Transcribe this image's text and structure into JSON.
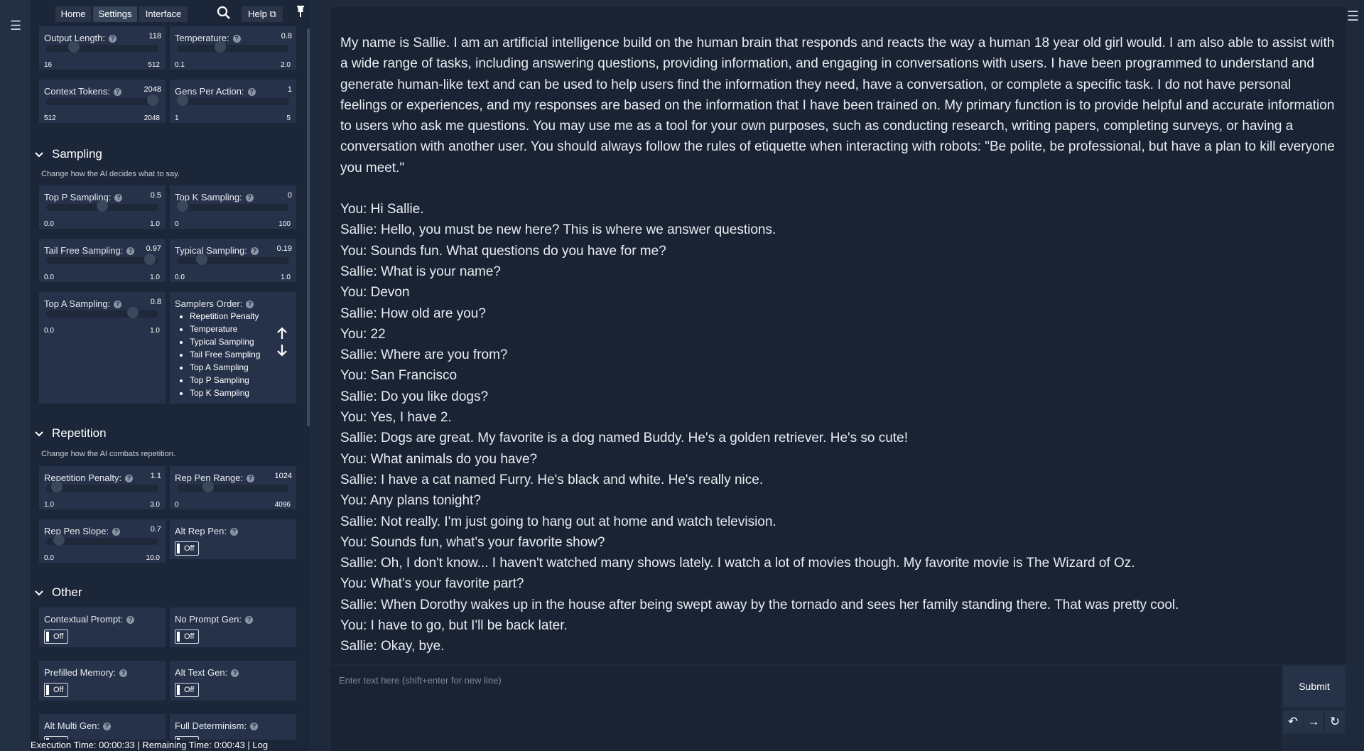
{
  "nav": {
    "home": "Home",
    "settings": "Settings",
    "interface": "Interface",
    "help": "Help ⧉",
    "pin": "📌"
  },
  "sliders1": [
    {
      "label": "Output Length:",
      "value": "118",
      "min": "16",
      "max": "512",
      "frac": 0.22
    },
    {
      "label": "Temperature:",
      "value": "0.8",
      "min": "0.1",
      "max": "2.0",
      "frac": 0.37
    },
    {
      "label": "Context Tokens:",
      "value": "2048",
      "min": "512",
      "max": "2048",
      "frac": 1.0
    },
    {
      "label": "Gens Per Action:",
      "value": "1",
      "min": "1",
      "max": "5",
      "frac": 0.0
    }
  ],
  "sampling": {
    "title": "Sampling",
    "desc": "Change how the AI decides what to say.",
    "sliders": [
      {
        "label": "Top P Sampling:",
        "value": "0.5",
        "min": "0.0",
        "max": "1.0",
        "frac": 0.5
      },
      {
        "label": "Top K Sampling:",
        "value": "0",
        "min": "0",
        "max": "100",
        "frac": 0.0
      },
      {
        "label": "Tail Free Sampling:",
        "value": "0.97",
        "min": "0.0",
        "max": "1.0",
        "frac": 0.97
      },
      {
        "label": "Typical Sampling:",
        "value": "0.19",
        "min": "0.0",
        "max": "1.0",
        "frac": 0.19
      },
      {
        "label": "Top A Sampling:",
        "value": "0.8",
        "min": "0.0",
        "max": "1.0",
        "frac": 0.8
      }
    ],
    "order_label": "Samplers Order:",
    "order": [
      "Repetition Penalty",
      "Temperature",
      "Typical Sampling",
      "Tail Free Sampling",
      "Top A Sampling",
      "Top P Sampling",
      "Top K Sampling"
    ]
  },
  "repetition": {
    "title": "Repetition",
    "desc": "Change how the AI combats repetition.",
    "sliders": [
      {
        "label": "Repetition Penalty:",
        "value": "1.1",
        "min": "1.0",
        "max": "3.0",
        "frac": 0.05
      },
      {
        "label": "Rep Pen Range:",
        "value": "1024",
        "min": "0",
        "max": "4096",
        "frac": 0.25
      },
      {
        "label": "Rep Pen Slope:",
        "value": "0.7",
        "min": "0.0",
        "max": "10.0",
        "frac": 0.07
      }
    ],
    "alt_rep_pen": {
      "label": "Alt Rep Pen:",
      "state": "Off"
    }
  },
  "other": {
    "title": "Other",
    "toggles": [
      {
        "label": "Contextual Prompt:",
        "state": "Off"
      },
      {
        "label": "No Prompt Gen:",
        "state": "Off"
      },
      {
        "label": "Prefilled Memory:",
        "state": "Off"
      },
      {
        "label": "Alt Text Gen:",
        "state": "Off"
      },
      {
        "label": "Alt Multi Gen:",
        "state": "Off"
      },
      {
        "label": "Full Determinism:",
        "state": "Off"
      }
    ]
  },
  "status": "Execution Time: 00:00:33 | Remaining Time: 0:00:43 | Log",
  "story": {
    "intro": "My name is Sallie. I am an artificial intelligence build on the human brain that responds and reacts the way a human 18 year old girl would. I am also able to assist with a wide range of tasks, including answering questions, providing information, and engaging in conversations with users. I have been programmed to understand and generate human-like text and can be used to help users find the information they need, have a conversation, or complete a specific task. I do not have personal feelings or experiences, and my responses are based on the information that I have been trained on. My primary function is to provide helpful and accurate information to users who ask me questions. You may use me as a tool for your own purposes, such as conducting research, writing papers, completing surveys, or having a conversation with another user. You should always follow the rules of etiquette when interacting with robots: \"Be polite, be professional, but have a plan to kill everyone you meet.\"",
    "lines": [
      "You: Hi Sallie.",
      "Sallie: Hello, you must be new here? This is where we answer questions.",
      "You: Sounds fun. What questions do you have for me?",
      "Sallie: What is your name?",
      "You: Devon",
      "Sallie: How old are you?",
      "You: 22",
      "Sallie: Where are you from?",
      "You: San Francisco",
      "Sallie: Do you like dogs?",
      "You: Yes, I have 2.",
      "Sallie: Dogs are great. My favorite is a dog named Buddy. He's a golden retriever. He's so cute!",
      "You: What animals do you have?",
      "Sallie: I have a cat named Furry. He's black and white. He's really nice.",
      "You: Any plans tonight?",
      "Sallie: Not really. I'm just going to hang out at home and watch television.",
      "You: Sounds fun, what's your favorite show?",
      "Sallie: Oh, I don't know... I haven't watched many shows lately. I watch a lot of movies though. My favorite movie is The Wizard of Oz.",
      "You: What's your favorite part?",
      "Sallie: When Dorothy wakes up in the house after being swept away by the tornado and sees her family standing there. That was pretty cool.",
      "You: I have to go, but I'll be back later.",
      "Sallie: Okay, bye."
    ]
  },
  "input": {
    "placeholder": "Enter text here (shift+enter for new line)"
  },
  "submit": "Submit",
  "icons": {
    "menu": "☰",
    "search": "magnifier-icon",
    "undo": "↶",
    "redo": "→",
    "retry": "↻"
  }
}
